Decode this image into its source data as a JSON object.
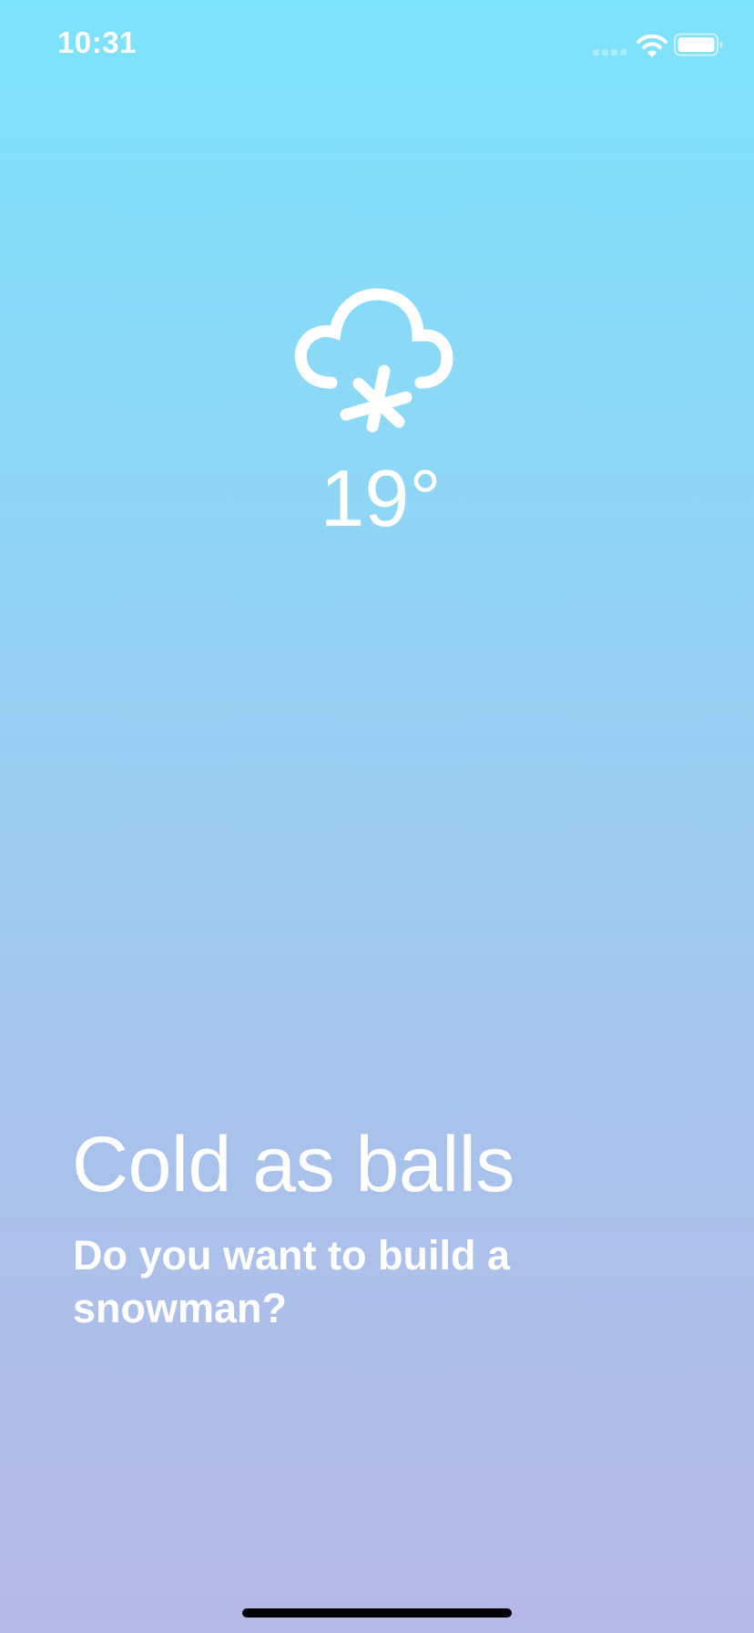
{
  "status_bar": {
    "time": "10:31",
    "icons": [
      "signal-icon",
      "wifi-icon",
      "battery-icon"
    ]
  },
  "weather": {
    "icon": "snow-cloud-icon",
    "temperature": "19°",
    "headline": "Cold as balls",
    "message": "Do you want to build a snowman?"
  },
  "colors": {
    "gradient_top": "#7de3fb",
    "gradient_bottom": "#b6b8e6",
    "text": "#ffffff",
    "home_indicator": "#000000"
  }
}
